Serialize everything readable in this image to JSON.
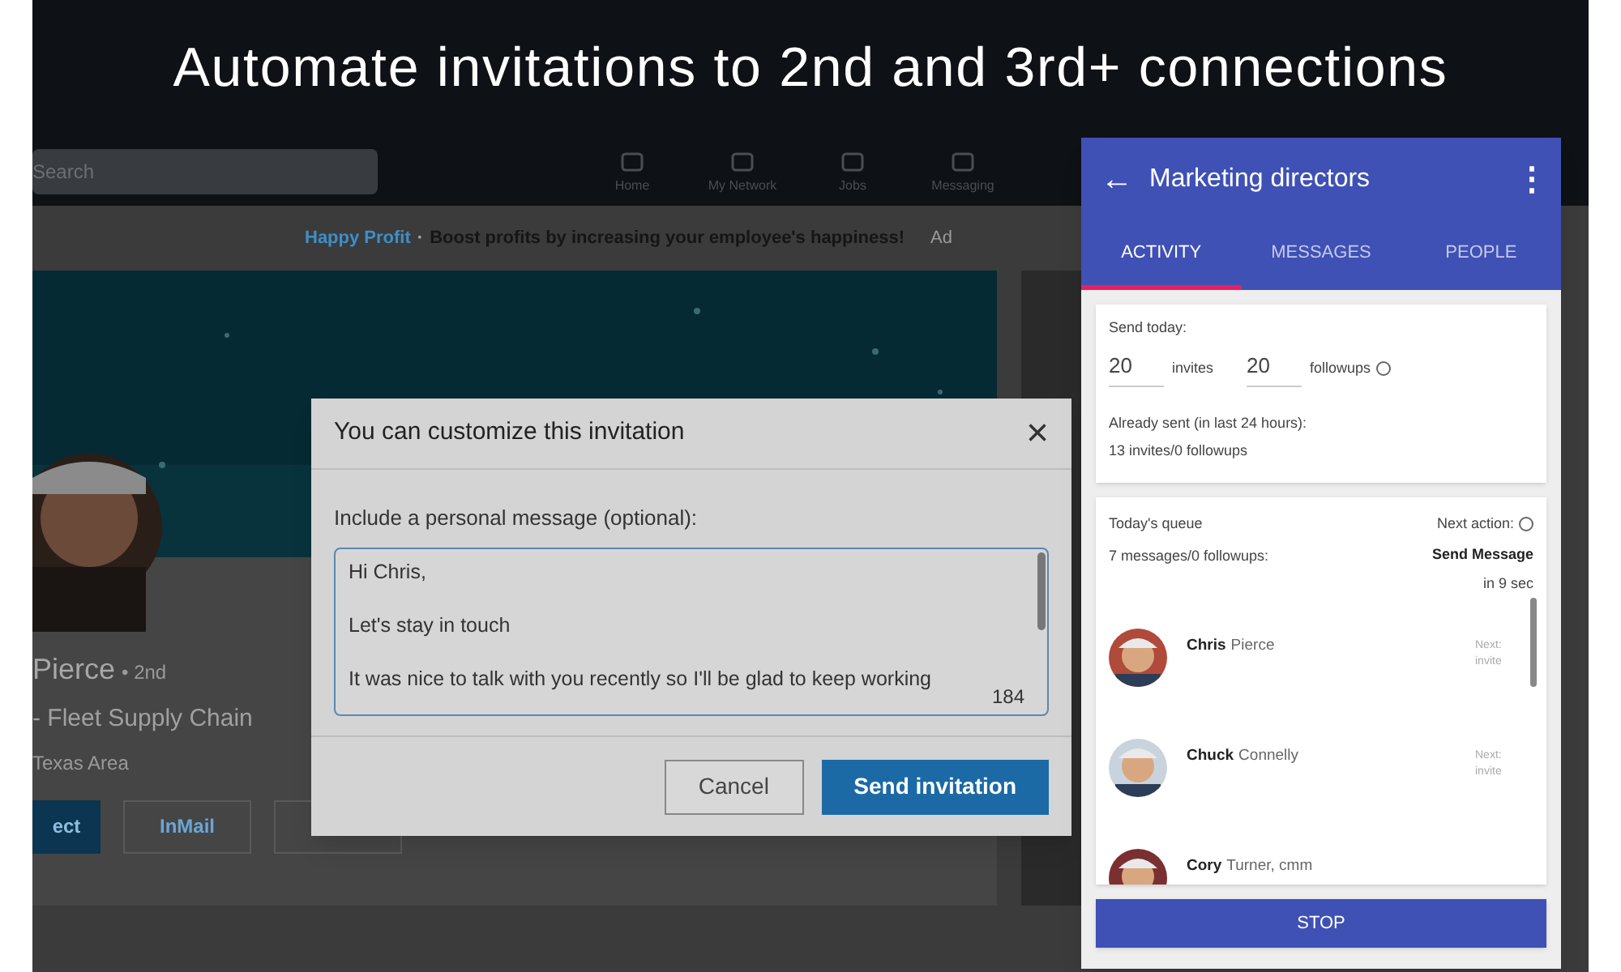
{
  "caption": "Automate invitations to 2nd and 3rd+ connections",
  "background_page": {
    "search": {
      "placeholder": "Search"
    },
    "nav": [
      {
        "label": "Home"
      },
      {
        "label": "My Network"
      },
      {
        "label": "Jobs"
      },
      {
        "label": "Messaging"
      }
    ],
    "ad": {
      "brand": "Happy Profit",
      "separator": "·",
      "text": "Boost profits by increasing your employee's happiness!",
      "tag": "Ad"
    },
    "profile": {
      "name": "Pierce",
      "degree": "• 2nd",
      "headline": "- Fleet Supply Chain",
      "location": "Texas Area",
      "buttons": [
        {
          "label": "ect",
          "kind": "primary"
        },
        {
          "label": "InMail",
          "kind": "outline"
        },
        {
          "kind": "outline"
        }
      ]
    }
  },
  "dialog": {
    "title": "You can customize this invitation",
    "close": "×",
    "prompt": "Include a personal message (optional):",
    "message": [
      "Hi Chris,",
      "Let's stay in touch",
      "It was nice to talk with you recently so I'll be glad to keep working"
    ],
    "counter": "184",
    "buttons": [
      {
        "label": "Cancel",
        "kind": "secondary"
      },
      {
        "label": "Send invitation",
        "kind": "primary"
      }
    ]
  },
  "panel": {
    "title": "Marketing directors",
    "back": "←",
    "menu": "⋮",
    "tabs": [
      {
        "label": "ACTIVITY",
        "selected": true
      },
      {
        "label": "MESSAGES",
        "selected": false
      },
      {
        "label": "PEOPLE",
        "selected": false
      }
    ],
    "send_today": {
      "label": "Send today:",
      "invites": {
        "value": "20",
        "unit": "invites"
      },
      "followups": {
        "value": "20",
        "unit": "followups"
      },
      "sent_label": "Already sent (in last 24 hours):",
      "sent_value": "13 invites/0 followups"
    },
    "queue": {
      "label": "Today's queue",
      "count": "7 messages/0 followups:",
      "next_label": "Next action:",
      "next_action": "Send Message",
      "next_time": "in 9 sec",
      "people": [
        {
          "first": "Chris",
          "last": "Pierce",
          "next_label": "Next:",
          "next": "invite"
        },
        {
          "first": "Chuck",
          "last": "Connelly",
          "next_label": "Next:",
          "next": "invite"
        },
        {
          "first": "Cory",
          "last": "Turner, cmm"
        }
      ]
    },
    "stop": "STOP"
  }
}
